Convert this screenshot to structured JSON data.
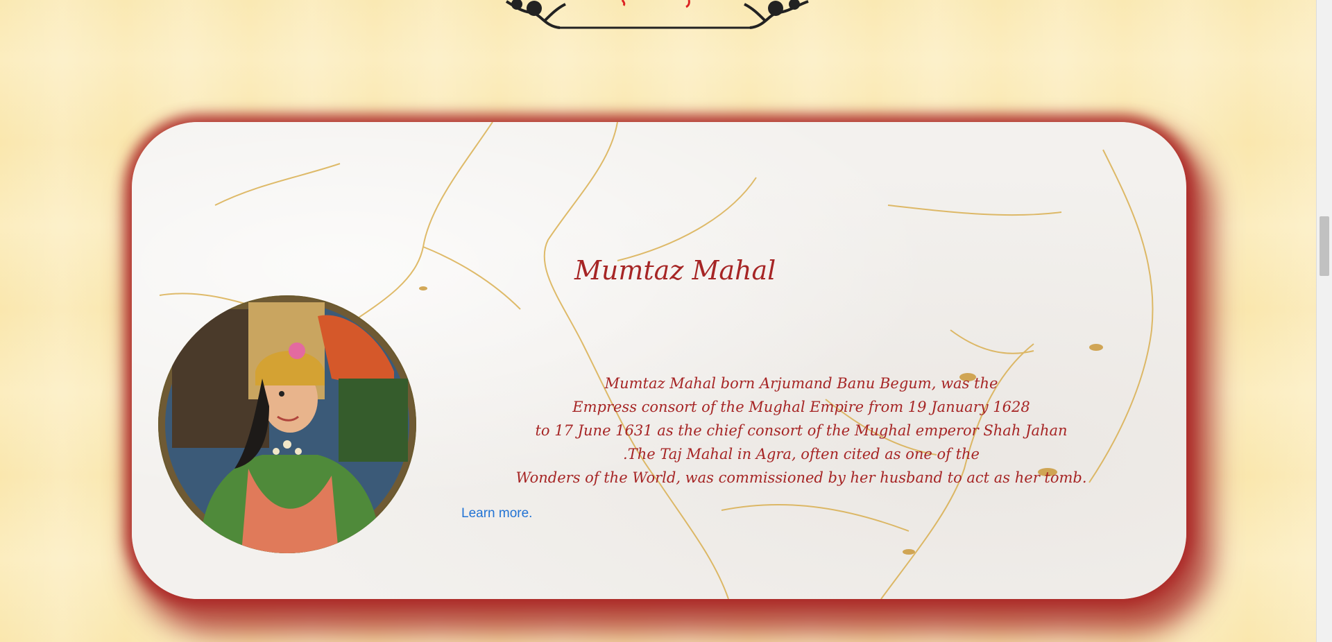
{
  "section": {
    "heading": "Mumtaz Mahal",
    "bio_lines": [
      "Mumtaz Mahal born Arjumand Banu Begum, was the",
      "Empress consort of the Mughal Empire from 19 January 1628",
      "to 17 June 1631 as the chief consort of the Mughal emperor Shah Jahan",
      ".The Taj Mahal in Agra, often cited as one of the",
      "Wonders of the World, was commissioned by her husband to act as her tomb."
    ],
    "learn_more": "Learn more.",
    "portrait_icon": "portrait-image"
  },
  "colors": {
    "heading": "#a62525",
    "link": "#2273d4",
    "page_bg": "#fbeab4",
    "card_shadow": "#aa2323"
  }
}
